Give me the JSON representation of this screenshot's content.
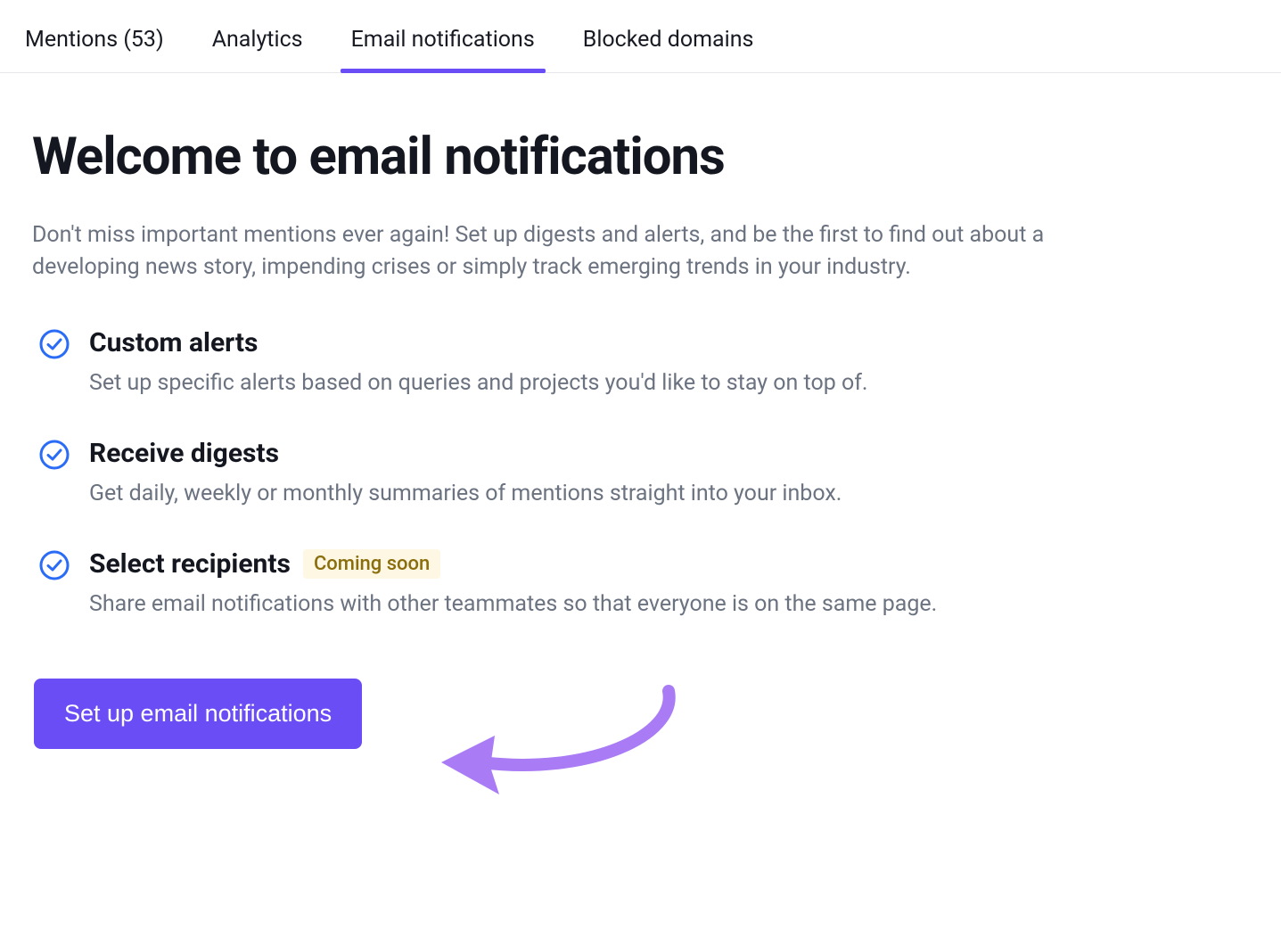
{
  "tabs": [
    {
      "label": "Mentions (53)",
      "active": false
    },
    {
      "label": "Analytics",
      "active": false
    },
    {
      "label": "Email notifications",
      "active": true
    },
    {
      "label": "Blocked domains",
      "active": false
    }
  ],
  "page": {
    "title": "Welcome to email notifications",
    "lead": "Don't miss important mentions ever again! Set up digests and alerts, and be the first to find out about a developing news story, impending crises or simply track emerging trends in your industry."
  },
  "features": [
    {
      "title": "Custom alerts",
      "desc": "Set up specific alerts based on queries and projects you'd like to stay on top of.",
      "badge": null
    },
    {
      "title": "Receive digests",
      "desc": "Get daily, weekly or monthly summaries of mentions straight into your inbox.",
      "badge": null
    },
    {
      "title": "Select recipients",
      "desc": "Share email notifications with other teammates so that everyone is on the same page.",
      "badge": "Coming soon"
    }
  ],
  "cta": {
    "label": "Set up email notifications"
  },
  "colors": {
    "accent": "#6a4df4",
    "check_stroke": "#2b6cf6",
    "text_muted": "#6b7280",
    "badge_bg": "#fdf7e3",
    "badge_text": "#8a6d0c",
    "arrow": "#a97bf5"
  }
}
